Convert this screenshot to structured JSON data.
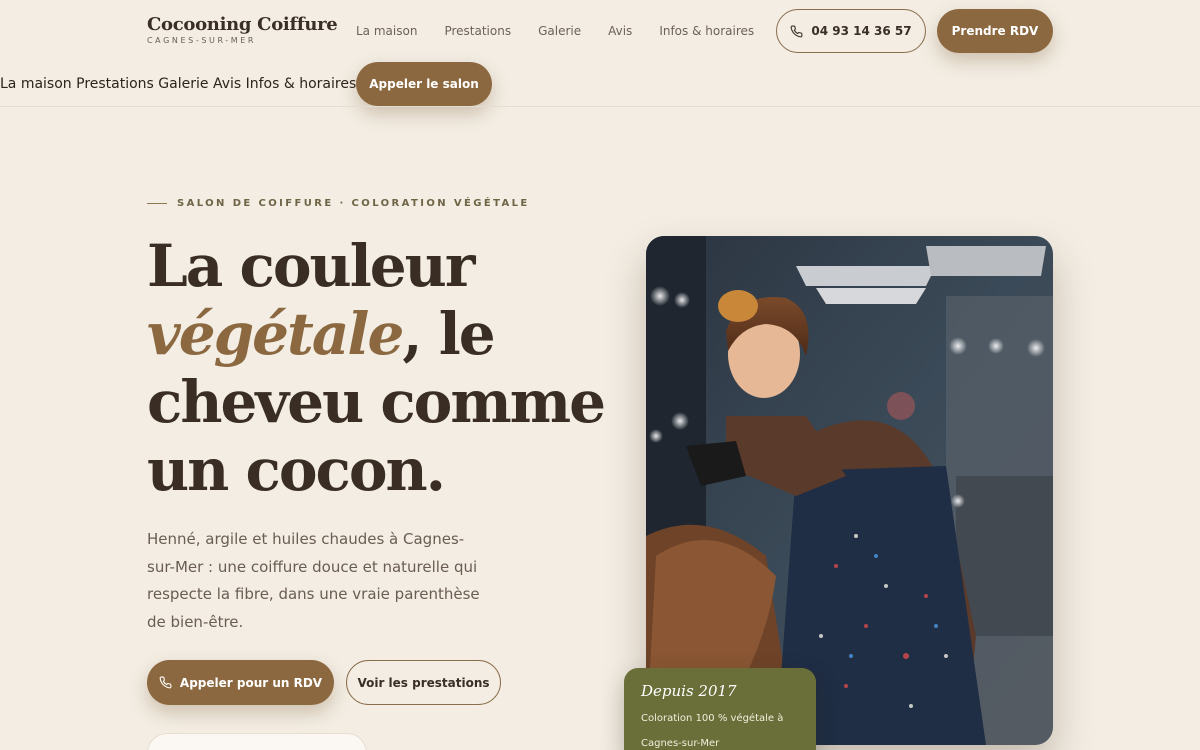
{
  "brand": {
    "name": "Cocooning Coiffure",
    "city": "CAGNES-SUR-MER"
  },
  "nav": [
    {
      "label": "La maison"
    },
    {
      "label": "Prestations"
    },
    {
      "label": "Galerie"
    },
    {
      "label": "Avis"
    },
    {
      "label": "Infos & horaires"
    }
  ],
  "header": {
    "phone": "04 93 14 36 57",
    "cta": "Prendre RDV"
  },
  "subnav": {
    "links": "La maison Prestations Galerie Avis Infos & horaires",
    "call": "Appeler le salon"
  },
  "hero": {
    "eyebrow": "SALON DE COIFFURE · COLORATION VÉGÉTALE",
    "headline": {
      "line1": "La couleur",
      "accent": "végétale",
      "line2_rest": ", le",
      "line3": "cheveu comme",
      "line4": "un cocon."
    },
    "lead": "Henné, argile et huiles chaudes à Cagnes-sur-Mer : une coiffure douce et naturelle qui respecte la fibre, dans une vraie parenthèse de bien-être.",
    "primary_cta": "Appeler pour un RDV",
    "secondary_cta": "Voir les prestations"
  },
  "badge": {
    "title": "Depuis 2017",
    "text": "Coloration 100 % végétale à Cagnes-sur-Mer"
  },
  "colors": {
    "accent": "#8b6840",
    "olive": "#6a6f3a",
    "background": "#f3ede3",
    "text": "#3a2e24"
  },
  "icons": {
    "phone": "phone-icon"
  }
}
